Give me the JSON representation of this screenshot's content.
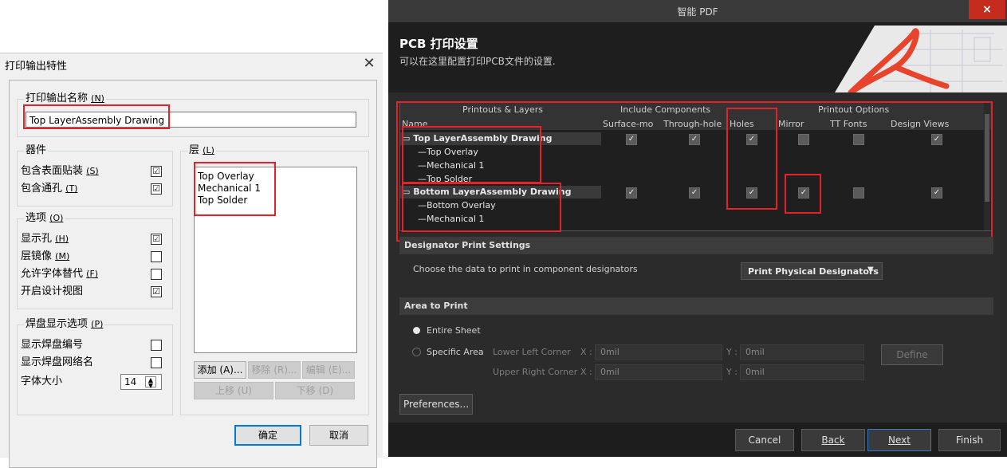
{
  "left_dialog": {
    "title": "打印输出特性",
    "close_glyph": "✕",
    "name_group_title": "打印输出名称",
    "name_group_key": "(N)",
    "name_value": "Top LayerAssembly Drawing",
    "components_group_title": "器件",
    "components": [
      {
        "label": "包含表面贴装",
        "key": "(S)",
        "checked": "☑"
      },
      {
        "label": "包含通孔",
        "key": "(T)",
        "checked": "☑"
      }
    ],
    "options_group_title": "选项",
    "options_group_key": "(O)",
    "options": [
      {
        "label": "显示孔",
        "key": "(H)",
        "checked": "☑"
      },
      {
        "label": "层镜像",
        "key": "(M)",
        "checked": ""
      },
      {
        "label": "允许字体替代",
        "key": "(F)",
        "checked": ""
      },
      {
        "label": "开启设计视图",
        "key": "",
        "checked": "☑"
      }
    ],
    "pad_group_title": "焊盘显示选项",
    "pad_group_key": "(P)",
    "pad_options": [
      {
        "label": "显示焊盘编号",
        "checked": ""
      },
      {
        "label": "显示焊盘网络名",
        "checked": ""
      }
    ],
    "font_size_label": "字体大小",
    "font_size_value": "14",
    "layers_group_title": "层",
    "layers_group_key": "(L)",
    "layers": [
      "Top Overlay",
      "Mechanical 1",
      "Top Solder"
    ],
    "buttons": {
      "add": "添加 (A)...",
      "remove": "移除 (R)...",
      "edit": "编辑 (E)...",
      "move_up": "上移 (U)",
      "move_down": "下移 (D)",
      "ok": "确定",
      "cancel": "取消"
    }
  },
  "right_dialog": {
    "window_title": "智能 PDF",
    "close_glyph": "×",
    "header_title": "PCB 打印设置",
    "header_subtitle": "可以在这里配置打印PCB文件的设置.",
    "table": {
      "group_headers": [
        "Printouts & Layers",
        "Include Components",
        "Printout Options"
      ],
      "col_name": "Name",
      "columns": [
        "Surface-mo",
        "Through-hole",
        "Holes",
        "Mirror",
        "TT Fonts",
        "Design Views"
      ],
      "printouts": [
        {
          "name": "Top LayerAssembly Drawing",
          "layers": [
            "Top Overlay",
            "Mechanical 1",
            "Top Solder"
          ],
          "checks": [
            "✓",
            "✓",
            "✓",
            "",
            "",
            "✓"
          ]
        },
        {
          "name": "Bottom LayerAssembly Drawing",
          "layers": [
            "Bottom Overlay",
            "Mechanical 1"
          ],
          "checks": [
            "✓",
            "✓",
            "✓",
            "✓",
            "",
            "✓"
          ]
        }
      ]
    },
    "designator_section": "Designator Print Settings",
    "designator_text": "Choose the data to print in component designators",
    "designator_dropdown": "Print Physical Designators",
    "area_section": "Area to Print",
    "area_entire": "Entire Sheet",
    "area_specific": "Specific Area",
    "lower_left_label": "Lower Left Corner",
    "upper_right_label": "Upper Right Corner",
    "x_label": "X :",
    "y_label": "Y :",
    "lower_left_x": "0mil",
    "lower_left_y": "0mil",
    "upper_right_x": "0mil",
    "upper_right_y": "0mil",
    "define_button": "Define",
    "preferences_button": "Preferences...",
    "footer_buttons": {
      "cancel": "Cancel",
      "back": "Back",
      "next": "Next",
      "finish": "Finish"
    }
  },
  "colors": {
    "highlight_red": "#e5212b",
    "acrobat_red": "#e8442c",
    "windows_accent": "#0078d7"
  }
}
